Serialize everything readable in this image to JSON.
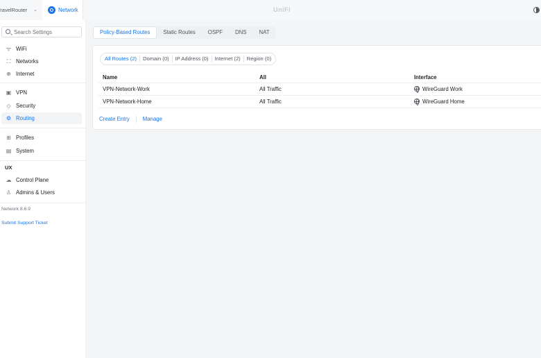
{
  "topbar": {
    "device_name": "TravelRouter",
    "app_name": "Network",
    "brand": "UniFi"
  },
  "sidebar": {
    "search_placeholder": "Search Settings",
    "items": [
      {
        "label": "WiFi",
        "icon": "wifi-icon"
      },
      {
        "label": "Networks",
        "icon": "networks-icon"
      },
      {
        "label": "Internet",
        "icon": "globe-icon"
      },
      {
        "label": "VPN",
        "icon": "vpn-icon"
      },
      {
        "label": "Security",
        "icon": "shield-icon"
      },
      {
        "label": "Routing",
        "icon": "routing-icon",
        "active": true
      },
      {
        "label": "Profiles",
        "icon": "profiles-icon"
      },
      {
        "label": "System",
        "icon": "system-icon"
      }
    ],
    "ux_section": "UX",
    "ux_items": [
      {
        "label": "Control Plane",
        "icon": "control-plane-icon"
      },
      {
        "label": "Admins & Users",
        "icon": "users-icon"
      }
    ],
    "version": "Network 8.6.9",
    "support_link": "Submit Support Ticket"
  },
  "main": {
    "tabs": [
      {
        "label": "Policy-Based Routes",
        "active": true
      },
      {
        "label": "Static Routes"
      },
      {
        "label": "OSPF"
      },
      {
        "label": "DNS"
      },
      {
        "label": "NAT"
      }
    ],
    "filters": [
      {
        "label": "All Routes (2)",
        "active": true
      },
      {
        "label": "Domain (0)"
      },
      {
        "label": "IP Address (0)"
      },
      {
        "label": "Internet (2)"
      },
      {
        "label": "Region (0)"
      }
    ],
    "table": {
      "headers": [
        "Name",
        "All",
        "Interface"
      ],
      "rows": [
        {
          "name": "VPN-Network-Work",
          "all": "All Traffic",
          "interface": "WireGuard Work"
        },
        {
          "name": "VPN-Network-Home",
          "all": "All Traffic",
          "interface": "WireGuard Home"
        }
      ]
    },
    "actions": {
      "create": "Create Entry",
      "manage": "Manage"
    }
  },
  "colors": {
    "accent": "#1a73e8",
    "text": "#212327",
    "muted": "#6c737c"
  }
}
